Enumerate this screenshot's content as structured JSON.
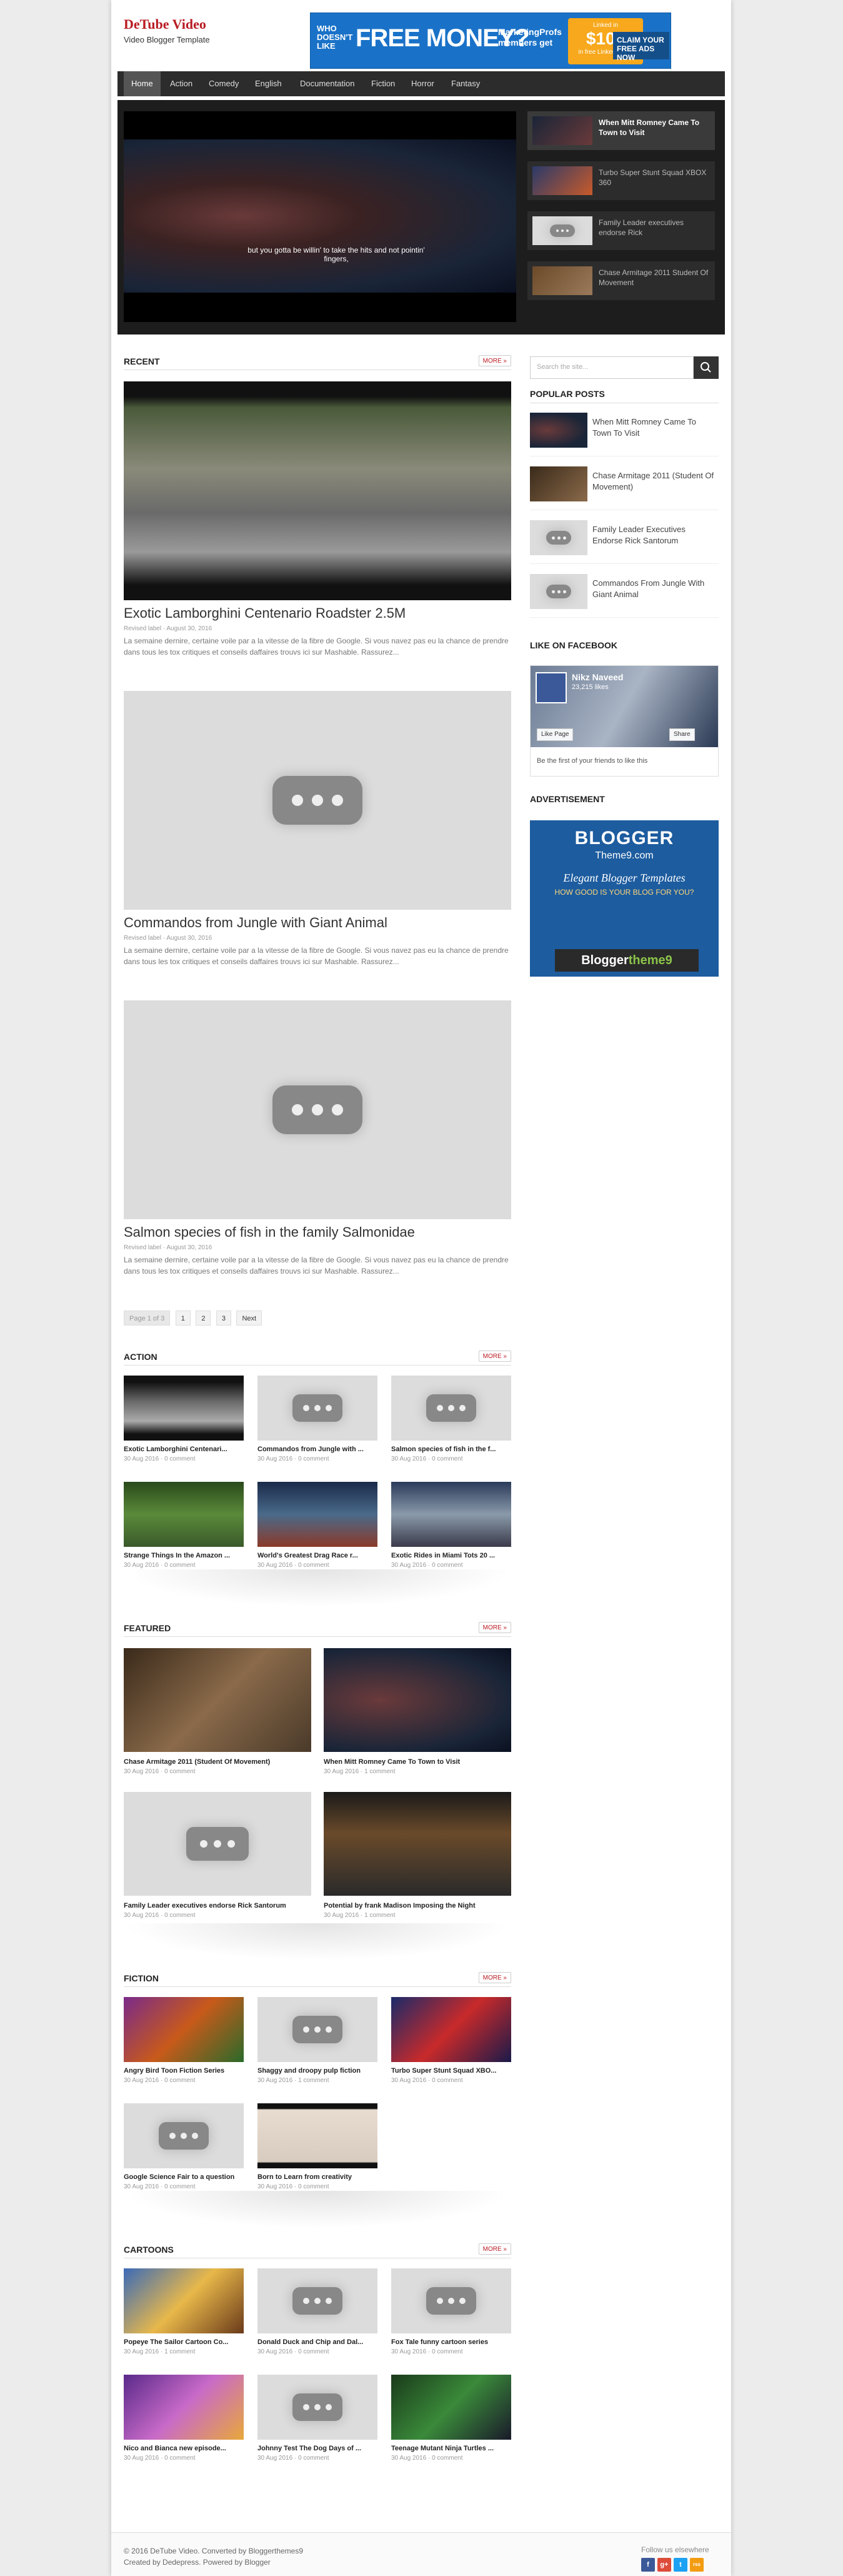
{
  "site": {
    "title": "DeTube Video",
    "subtitle": "Video Blogger Template"
  },
  "ad_banner": {
    "who": "WHO DOESN'T LIKE",
    "free_money": "FREE MONEY?",
    "marketing": "MarketingProfs members get",
    "linkedin": "Linked in",
    "amount": "$100",
    "linkedin_text": "in free LinkedIn ads",
    "claim": "CLAIM YOUR FREE ADS NOW"
  },
  "nav": {
    "items": [
      "Home",
      "Action",
      "Comedy",
      "English",
      "Documentation",
      "Fiction",
      "Horror",
      "Fantasy"
    ]
  },
  "slider": {
    "caption": "but you gotta be willin' to take the hits and not pointin' fingers,",
    "items": [
      "When Mitt Romney Came To Town to Visit",
      "Turbo Super Stunt Squad XBOX 360",
      "Family Leader executives endorse Rick",
      "Chase Armitage 2011 Student Of Movement"
    ]
  },
  "recent": {
    "heading": "RECENT",
    "more": "MORE »",
    "posts": [
      {
        "title": "Exotic Lamborghini Centenario Roadster 2.5M",
        "author": "Revised label",
        "date": "August 30, 2016",
        "excerpt": "La semaine dernire, certaine voile par a la vitesse de la fibre de Google. Si vous navez pas eu la chance de prendre dans tous les tox critiques et conseils daffaires trouvs ici sur Mashable. Rassurez..."
      },
      {
        "title": "Commandos from Jungle with Giant Animal",
        "author": "Revised label",
        "date": "August 30, 2016",
        "excerpt": "La semaine dernire, certaine voile par a la vitesse de la fibre de Google. Si vous navez pas eu la chance de prendre dans tous les tox critiques et conseils daffaires trouvs ici sur Mashable. Rassurez..."
      },
      {
        "title": "Salmon species of fish in the family Salmonidae",
        "author": "Revised label",
        "date": "August 30, 2016",
        "excerpt": "La semaine dernire, certaine voile par a la vitesse de la fibre de Google. Si vous navez pas eu la chance de prendre dans tous les tox critiques et conseils daffaires trouvs ici sur Mashable. Rassurez..."
      }
    ],
    "pager": {
      "label": "Page 1 of 3",
      "pages": [
        "1",
        "2",
        "3"
      ],
      "next": "Next"
    }
  },
  "action": {
    "heading": "ACTION",
    "more": "MORE »",
    "items": [
      {
        "title": "Exotic Lamborghini Centenari...",
        "date": "30 Aug 2016",
        "comments": "0 comment"
      },
      {
        "title": "Commandos from Jungle with ...",
        "date": "30 Aug 2016",
        "comments": "0 comment"
      },
      {
        "title": "Salmon species of fish in the f...",
        "date": "30 Aug 2016",
        "comments": "0 comment"
      },
      {
        "title": "Strange Things In the Amazon ...",
        "date": "30 Aug 2016",
        "comments": "0 comment"
      },
      {
        "title": "World's Greatest Drag Race r...",
        "date": "30 Aug 2016",
        "comments": "0 comment"
      },
      {
        "title": "Exotic Rides in Miami Tots 20 ...",
        "date": "30 Aug 2016",
        "comments": "0 comment"
      }
    ]
  },
  "featured": {
    "heading": "FEATURED",
    "more": "MORE »",
    "items": [
      {
        "title": "Chase Armitage 2011 (Student Of Movement)",
        "date": "30 Aug 2016",
        "comments": "0 comment"
      },
      {
        "title": "When Mitt Romney Came To Town to Visit",
        "date": "30 Aug 2016",
        "comments": "1 comment"
      },
      {
        "title": "Family Leader executives endorse Rick Santorum",
        "date": "30 Aug 2016",
        "comments": "0 comment"
      },
      {
        "title": "Potential by frank Madison Imposing the Night",
        "date": "30 Aug 2016",
        "comments": "1 comment"
      }
    ]
  },
  "fiction": {
    "heading": "FICTION",
    "more": "MORE »",
    "items": [
      {
        "title": "Angry Bird Toon Fiction Series",
        "date": "30 Aug 2016",
        "comments": "0 comment"
      },
      {
        "title": "Shaggy and droopy pulp fiction",
        "date": "30 Aug 2016",
        "comments": "1 comment"
      },
      {
        "title": "Turbo Super Stunt Squad XBO...",
        "date": "30 Aug 2016",
        "comments": "0 comment"
      },
      {
        "title": "Google Science Fair to a question",
        "date": "30 Aug 2016",
        "comments": "0 comment"
      },
      {
        "title": "Born to Learn from creativity",
        "date": "30 Aug 2016",
        "comments": "0 comment"
      }
    ]
  },
  "cartoons": {
    "heading": "CARTOONS",
    "more": "MORE »",
    "items": [
      {
        "title": "Popeye The Sailor Cartoon Co...",
        "date": "30 Aug 2016",
        "comments": "1 comment"
      },
      {
        "title": "Donald Duck and Chip and Dal...",
        "date": "30 Aug 2016",
        "comments": "0 comment"
      },
      {
        "title": "Fox Tale funny cartoon series",
        "date": "30 Aug 2016",
        "comments": "0 comment"
      },
      {
        "title": "Nico and Bianca new episode...",
        "date": "30 Aug 2016",
        "comments": "0 comment"
      },
      {
        "title": "Johnny Test The Dog Days of ...",
        "date": "30 Aug 2016",
        "comments": "0 comment"
      },
      {
        "title": "Teenage Mutant Ninja Turtles ...",
        "date": "30 Aug 2016",
        "comments": "0 comment"
      }
    ]
  },
  "sidebar": {
    "search_placeholder": "Search the site...",
    "popular_title": "POPULAR POSTS",
    "popular": [
      "When Mitt Romney Came To Town To Visit",
      "Chase Armitage 2011 (Student Of Movement)",
      "Family Leader Executives Endorse Rick Santorum",
      "Commandos From Jungle With Giant Animal"
    ],
    "facebook_title": "LIKE ON FACEBOOK",
    "fb_name": "Nikz Naveed",
    "fb_likes": "23,215 likes",
    "fb_like_page": "Like Page",
    "fb_share": "Share",
    "fb_friends": "Be the first of your friends to like this",
    "ad_title": "ADVERTISEMENT",
    "ad": {
      "blogger": "BLOGGER",
      "theme9": "Theme9.com",
      "elegant": "Elegant Blogger Templates",
      "good": "HOW GOOD IS YOUR BLOG FOR YOU?",
      "brand": "Blogger",
      "brand2": "theme9"
    }
  },
  "footer": {
    "line1": "© 2016 DeTube Video. Converted by Bloggerthemes9",
    "line2": "Created by Dedepress. Powered by Blogger",
    "follow": "Follow us elsewhere",
    "social": [
      "f",
      "g+",
      "t",
      "rss"
    ]
  },
  "colors": {
    "accent": "#b81c23",
    "nav_bg": "#2c2c2c",
    "slider_bg": "#1d1d1d"
  }
}
